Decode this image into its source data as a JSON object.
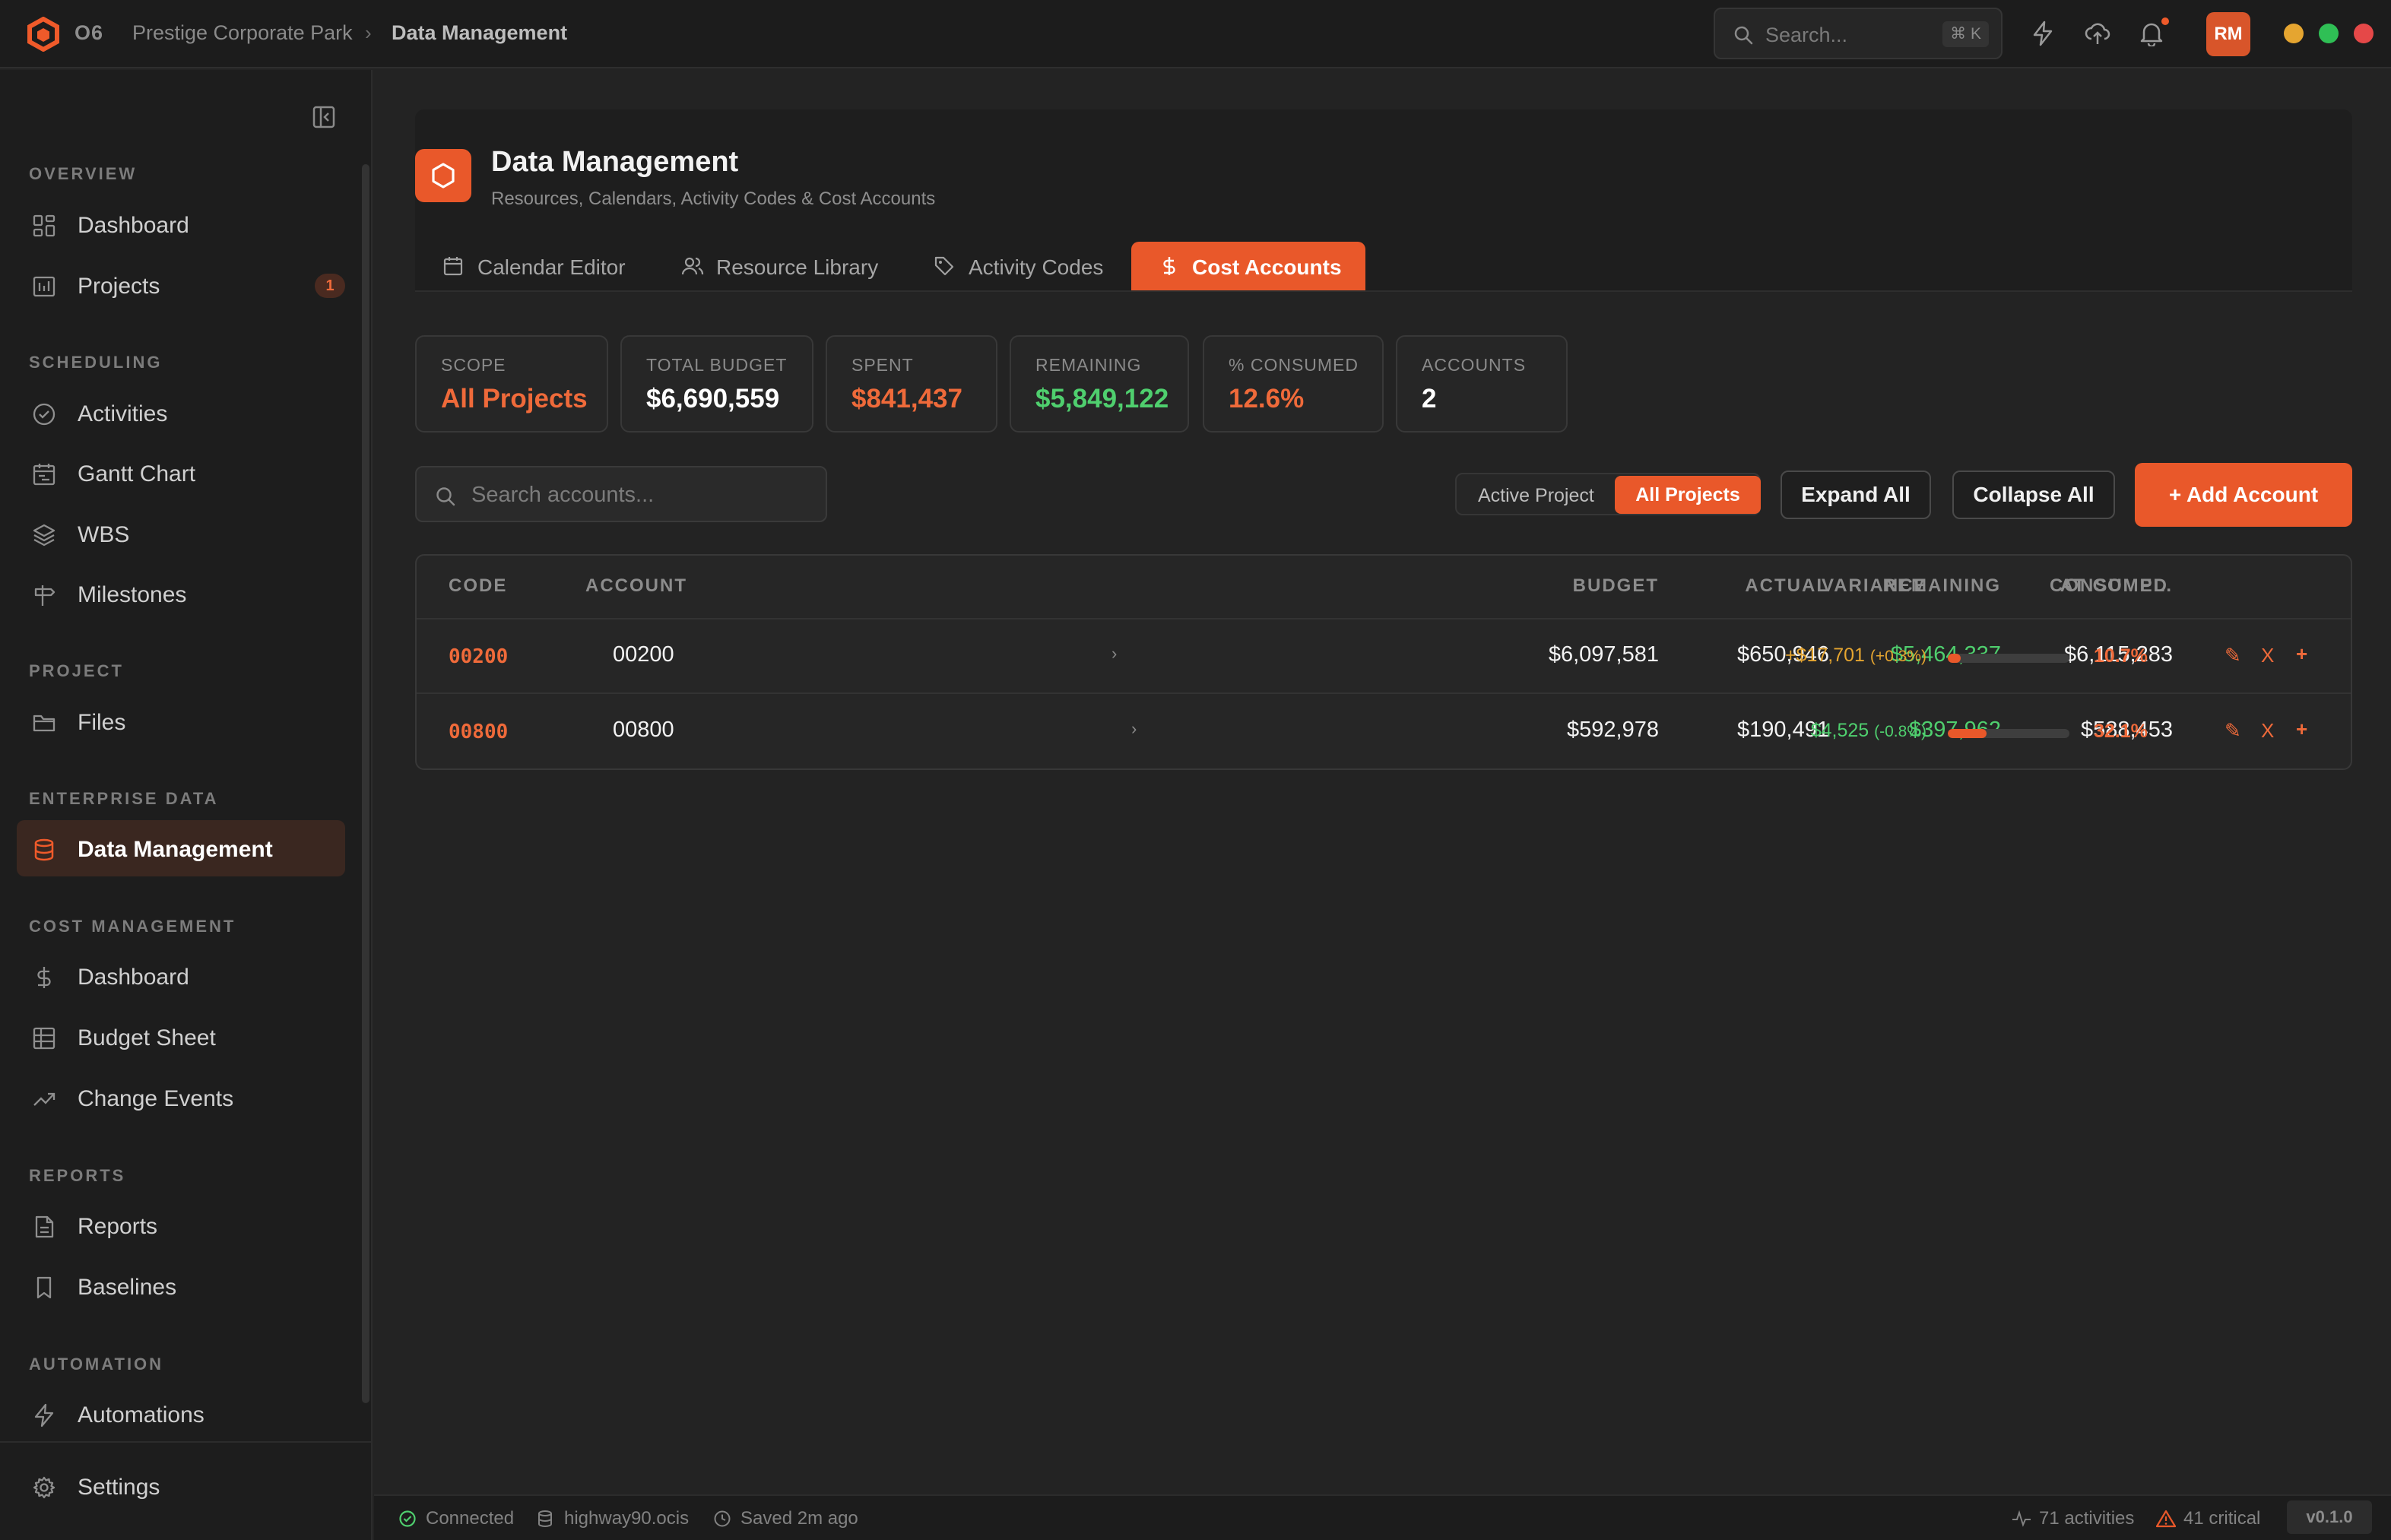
{
  "app": {
    "name": "O6"
  },
  "breadcrumb": {
    "project": "Prestige Corporate Park",
    "separator": "›",
    "current": "Data Management"
  },
  "topbar": {
    "search_placeholder": "Search...",
    "search_shortcut": "⌘ K",
    "avatar_initials": "RM",
    "window_controls": [
      "#e5a530",
      "#2fbf55",
      "#e54848"
    ]
  },
  "sidebar": {
    "sections": [
      {
        "title": "OVERVIEW",
        "items": [
          {
            "label": "Dashboard",
            "icon": "grid-icon"
          },
          {
            "label": "Projects",
            "icon": "chart-icon",
            "badge": "1"
          }
        ]
      },
      {
        "title": "SCHEDULING",
        "items": [
          {
            "label": "Activities",
            "icon": "check-circle-icon"
          },
          {
            "label": "Gantt Chart",
            "icon": "calendar-icon"
          },
          {
            "label": "WBS",
            "icon": "layers-icon"
          },
          {
            "label": "Milestones",
            "icon": "signpost-icon"
          }
        ]
      },
      {
        "title": "PROJECT",
        "items": [
          {
            "label": "Files",
            "icon": "folder-icon"
          }
        ]
      },
      {
        "title": "ENTERPRISE DATA",
        "items": [
          {
            "label": "Data Management",
            "icon": "database-icon",
            "active": true
          }
        ]
      },
      {
        "title": "COST MANAGEMENT",
        "items": [
          {
            "label": "Dashboard",
            "icon": "dollar-icon"
          },
          {
            "label": "Budget Sheet",
            "icon": "table-icon"
          },
          {
            "label": "Change Events",
            "icon": "trend-icon"
          }
        ]
      },
      {
        "title": "REPORTS",
        "items": [
          {
            "label": "Reports",
            "icon": "document-icon"
          },
          {
            "label": "Baselines",
            "icon": "bookmark-icon"
          }
        ]
      },
      {
        "title": "AUTOMATION",
        "items": [
          {
            "label": "Automations",
            "icon": "bolt-icon"
          }
        ]
      }
    ],
    "settings_label": "Settings"
  },
  "page": {
    "title": "Data Management",
    "subtitle": "Resources, Calendars, Activity Codes & Cost Accounts",
    "tabs": [
      {
        "label": "Calendar Editor",
        "icon": "calendar-icon"
      },
      {
        "label": "Resource Library",
        "icon": "users-icon"
      },
      {
        "label": "Activity Codes",
        "icon": "tag-icon"
      },
      {
        "label": "Cost Accounts",
        "icon": "dollar-icon",
        "active": true
      }
    ]
  },
  "stats": [
    {
      "label": "SCOPE",
      "value": "All Projects",
      "color": "#ef6a3a"
    },
    {
      "label": "TOTAL BUDGET",
      "value": "$6,690,559",
      "color": "#ffffff"
    },
    {
      "label": "SPENT",
      "value": "$841,437",
      "color": "#ef6a3a"
    },
    {
      "label": "REMAINING",
      "value": "$5,849,122",
      "color": "#4fcf6e"
    },
    {
      "label": "% CONSUMED",
      "value": "12.6%",
      "color": "#ef6a3a"
    },
    {
      "label": "ACCOUNTS",
      "value": "2",
      "color": "#ffffff"
    }
  ],
  "toolbar": {
    "search_placeholder": "Search accounts...",
    "scope_options": [
      "Active Project",
      "All Projects"
    ],
    "scope_selected": "All Projects",
    "expand_label": "Expand All",
    "collapse_label": "Collapse All",
    "add_label": "+ Add Account"
  },
  "table": {
    "headers": [
      "CODE",
      "ACCOUNT",
      "BUDGET",
      "ACTUAL",
      "REMAINING",
      "AT COMPL.",
      "VARIANCE",
      "CONSUMED"
    ],
    "rows": [
      {
        "code": "00200",
        "account": "00200",
        "budget": "$6,097,581",
        "actual": "$650,946",
        "remaining": "$5,464,337",
        "at_completion": "$6,115,283",
        "variance": "+$17,701",
        "variance_pct": "(+0.3%)",
        "variance_color": "#e5a530",
        "consumed_pct": "10.7%",
        "consumed_fraction": 0.107
      },
      {
        "code": "00800",
        "account": "00800",
        "budget": "$592,978",
        "actual": "$190,491",
        "remaining": "$397,962",
        "at_completion": "$588,453",
        "variance": "$4,525",
        "variance_pct": "(-0.8%)",
        "variance_color": "#4fcf6e",
        "consumed_pct": "32.1%",
        "consumed_fraction": 0.321
      }
    ],
    "actions": {
      "edit": "✎",
      "delete": "X",
      "add": "+"
    }
  },
  "statusbar": {
    "connection": "Connected",
    "file": "highway90.ocis",
    "saved": "Saved 2m ago",
    "activities": "71 activities",
    "critical": "41 critical",
    "version": "v0.1.0"
  }
}
